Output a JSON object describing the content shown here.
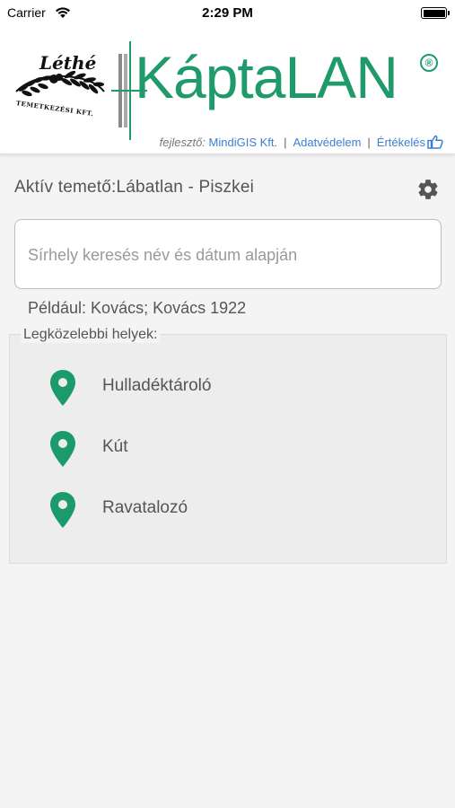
{
  "status_bar": {
    "carrier": "Carrier",
    "time": "2:29 PM"
  },
  "header": {
    "lethe_logo_text": "Léthé",
    "lethe_logo_subtitle": "TEMETKEZÉSI KFT.",
    "brand_name": "KáptaLAN",
    "registered_mark": "®",
    "developer_label": "fejlesztő:",
    "developer_link": "MindiGIS Kft.",
    "privacy_link": "Adatvédelem",
    "rating_link": "Értékelés",
    "separator": "|"
  },
  "active_cemetery": {
    "label": "Aktív temető:Lábatlan - Piszkei"
  },
  "search": {
    "placeholder": "Sírhely keresés név és dátum alapján",
    "value": "",
    "hint": "Például: Kovács; Kovács 1922"
  },
  "nearest": {
    "title": "Legközelebbi helyek:",
    "places": [
      {
        "name": "Hulladéktároló",
        "icon": "map-pin-icon"
      },
      {
        "name": "Kút",
        "icon": "map-pin-icon"
      },
      {
        "name": "Ravatalozó",
        "icon": "map-pin-icon"
      }
    ]
  },
  "colors": {
    "brand_green": "#1e9a6b",
    "link_blue": "#3a7fd0",
    "pin_green": "#1b9a6c"
  },
  "icons": [
    "wifi-icon",
    "battery-icon",
    "thumbs-up-icon",
    "gear-icon",
    "map-pin-icon"
  ]
}
